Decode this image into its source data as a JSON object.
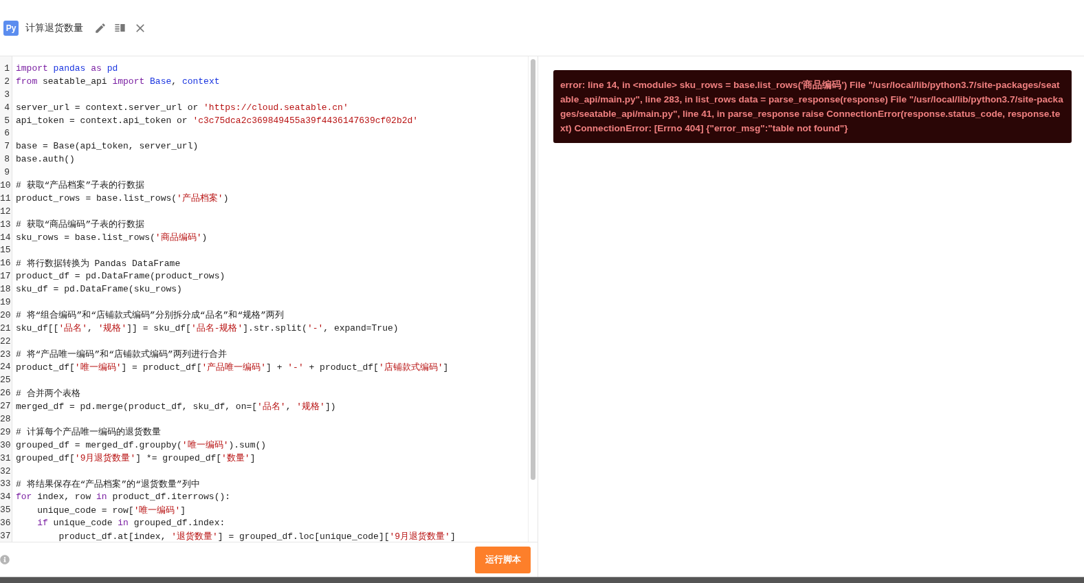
{
  "header": {
    "badge": "Py",
    "title": "计算退货数量"
  },
  "editor": {
    "lines": [
      {
        "number": "1",
        "tokens": [
          {
            "kind": "keyword",
            "text": "import"
          },
          {
            "kind": "builtin",
            "text": " pandas"
          },
          {
            "kind": "keyword",
            "text": " as"
          },
          {
            "kind": "builtin",
            "text": " pd"
          }
        ]
      },
      {
        "number": "2",
        "tokens": [
          {
            "kind": "keyword",
            "text": "from"
          },
          {
            "kind": "plain",
            "text": " seatable_api "
          },
          {
            "kind": "keyword",
            "text": "import"
          },
          {
            "kind": "builtin",
            "text": " Base"
          },
          {
            "kind": "plain",
            "text": ", "
          },
          {
            "kind": "builtin",
            "text": "context"
          }
        ]
      },
      {
        "number": "3"
      },
      {
        "number": "4",
        "tokens": [
          {
            "kind": "plain",
            "text": "server_url = context.server_url or "
          },
          {
            "kind": "string",
            "text": "'https://cloud.seatable.cn'"
          }
        ]
      },
      {
        "number": "5",
        "tokens": [
          {
            "kind": "plain",
            "text": "api_token = context.api_token or "
          },
          {
            "kind": "string",
            "text": "'c3c75dca2c369849455a39f4436147639cf02b2d'"
          }
        ]
      },
      {
        "number": "6"
      },
      {
        "number": "7",
        "tokens": [
          {
            "kind": "plain",
            "text": "base = Base(api_token, server_url)"
          }
        ]
      },
      {
        "number": "8",
        "tokens": [
          {
            "kind": "plain",
            "text": "base.auth()"
          }
        ]
      },
      {
        "number": "9"
      },
      {
        "number": "10",
        "tokens": [
          {
            "kind": "comment",
            "text": "# 获取“产品档案”子表的行数据"
          }
        ]
      },
      {
        "number": "11",
        "tokens": [
          {
            "kind": "plain",
            "text": "product_rows = base.list_rows("
          },
          {
            "kind": "string",
            "text": "'产品档案'"
          },
          {
            "kind": "plain",
            "text": ")"
          }
        ]
      },
      {
        "number": "12"
      },
      {
        "number": "13",
        "tokens": [
          {
            "kind": "comment",
            "text": "# 获取“商品编码”子表的行数据"
          }
        ]
      },
      {
        "number": "14",
        "tokens": [
          {
            "kind": "plain",
            "text": "sku_rows = base.list_rows("
          },
          {
            "kind": "string",
            "text": "'商品编码'"
          },
          {
            "kind": "plain",
            "text": ")"
          }
        ]
      },
      {
        "number": "15"
      },
      {
        "number": "16",
        "tokens": [
          {
            "kind": "comment",
            "text": "# 将行数据转换为 Pandas DataFrame"
          }
        ]
      },
      {
        "number": "17",
        "tokens": [
          {
            "kind": "plain",
            "text": "product_df = pd.DataFrame(product_rows)"
          }
        ]
      },
      {
        "number": "18",
        "tokens": [
          {
            "kind": "plain",
            "text": "sku_df = pd.DataFrame(sku_rows)"
          }
        ]
      },
      {
        "number": "19"
      },
      {
        "number": "20",
        "tokens": [
          {
            "kind": "comment",
            "text": "# 将“组合编码”和“店铺款式编码”分别拆分成“品名”和“规格”两列"
          }
        ]
      },
      {
        "number": "21",
        "tokens": [
          {
            "kind": "plain",
            "text": "sku_df[["
          },
          {
            "kind": "string",
            "text": "'品名'"
          },
          {
            "kind": "plain",
            "text": ", "
          },
          {
            "kind": "string",
            "text": "'规格'"
          },
          {
            "kind": "plain",
            "text": "]] = sku_df["
          },
          {
            "kind": "string",
            "text": "'品名-规格'"
          },
          {
            "kind": "plain",
            "text": "].str.split("
          },
          {
            "kind": "string",
            "text": "'-'"
          },
          {
            "kind": "plain",
            "text": ", expand=True)"
          }
        ]
      },
      {
        "number": "22"
      },
      {
        "number": "23",
        "tokens": [
          {
            "kind": "comment",
            "text": "# 将“产品唯一编码”和“店铺款式编码”两列进行合并"
          }
        ]
      },
      {
        "number": "24",
        "tokens": [
          {
            "kind": "plain",
            "text": "product_df["
          },
          {
            "kind": "string",
            "text": "'唯一编码'"
          },
          {
            "kind": "plain",
            "text": "] = product_df["
          },
          {
            "kind": "string",
            "text": "'产品唯一编码'"
          },
          {
            "kind": "plain",
            "text": "] + "
          },
          {
            "kind": "string",
            "text": "'-'"
          },
          {
            "kind": "plain",
            "text": " + product_df["
          },
          {
            "kind": "string",
            "text": "'店铺款式编码'"
          },
          {
            "kind": "plain",
            "text": "]"
          }
        ]
      },
      {
        "number": "25"
      },
      {
        "number": "26",
        "tokens": [
          {
            "kind": "comment",
            "text": "# 合并两个表格"
          }
        ]
      },
      {
        "number": "27",
        "tokens": [
          {
            "kind": "plain",
            "text": "merged_df = pd.merge(product_df, sku_df, on=["
          },
          {
            "kind": "string",
            "text": "'品名'"
          },
          {
            "kind": "plain",
            "text": ", "
          },
          {
            "kind": "string",
            "text": "'规格'"
          },
          {
            "kind": "plain",
            "text": "])"
          }
        ]
      },
      {
        "number": "28"
      },
      {
        "number": "29",
        "tokens": [
          {
            "kind": "comment",
            "text": "# 计算每个产品唯一编码的退货数量"
          }
        ]
      },
      {
        "number": "30",
        "tokens": [
          {
            "kind": "plain",
            "text": "grouped_df = merged_df.groupby("
          },
          {
            "kind": "string",
            "text": "'唯一编码'"
          },
          {
            "kind": "plain",
            "text": ").sum()"
          }
        ]
      },
      {
        "number": "31",
        "tokens": [
          {
            "kind": "plain",
            "text": "grouped_df["
          },
          {
            "kind": "string",
            "text": "'9月退货数量'"
          },
          {
            "kind": "plain",
            "text": "] *= grouped_df["
          },
          {
            "kind": "string",
            "text": "'数量'"
          },
          {
            "kind": "plain",
            "text": "]"
          }
        ]
      },
      {
        "number": "32"
      },
      {
        "number": "33",
        "tokens": [
          {
            "kind": "comment",
            "text": "# 将结果保存在“产品档案”的“退货数量”列中"
          }
        ]
      },
      {
        "number": "34",
        "tokens": [
          {
            "kind": "keyword",
            "text": "for"
          },
          {
            "kind": "plain",
            "text": " index, row "
          },
          {
            "kind": "keyword",
            "text": "in"
          },
          {
            "kind": "plain",
            "text": " product_df.iterrows():"
          }
        ]
      },
      {
        "number": "35",
        "tokens": [
          {
            "kind": "plain",
            "text": "    unique_code = row["
          },
          {
            "kind": "string",
            "text": "'唯一编码'"
          },
          {
            "kind": "plain",
            "text": "]"
          }
        ]
      },
      {
        "number": "36",
        "tokens": [
          {
            "kind": "keyword",
            "text": "    if"
          },
          {
            "kind": "plain",
            "text": " unique_code "
          },
          {
            "kind": "keyword",
            "text": "in"
          },
          {
            "kind": "plain",
            "text": " grouped_df.index:"
          }
        ]
      },
      {
        "number": "37",
        "tokens": [
          {
            "kind": "plain",
            "text": "        product_df.at[index, "
          },
          {
            "kind": "string",
            "text": "'退货数量'"
          },
          {
            "kind": "plain",
            "text": "] = grouped_df.loc[unique_code]["
          },
          {
            "kind": "string",
            "text": "'9月退货数量'"
          },
          {
            "kind": "plain",
            "text": "]"
          }
        ]
      }
    ]
  },
  "run_button": "运行脚本",
  "output": {
    "error": "error: line 14, in <module> sku_rows = base.list_rows('商品编码') File \"/usr/local/lib/python3.7/site-packages/seatable_api/main.py\", line 283, in list_rows data = parse_response(response) File \"/usr/local/lib/python3.7/site-packages/seatable_api/main.py\", line 41, in parse_response raise ConnectionError(response.status_code, response.text) ConnectionError: [Errno 404] {\"error_msg\":\"table not found\"}"
  }
}
